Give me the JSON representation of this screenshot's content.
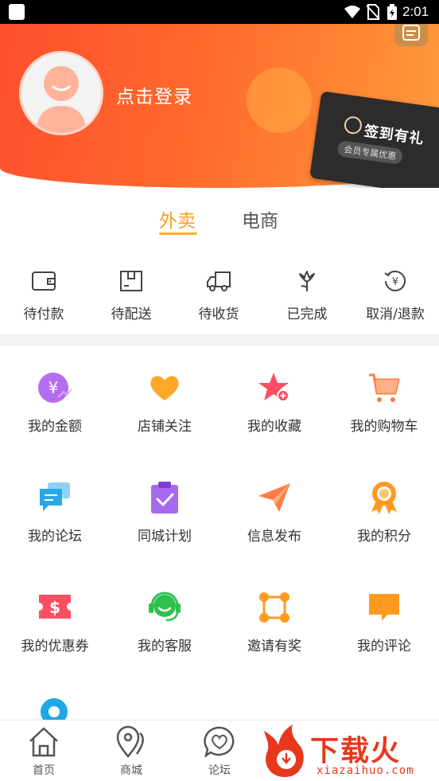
{
  "status_bar": {
    "time": "2:01"
  },
  "header": {
    "login_text": "点击登录",
    "signin_card": {
      "title": "签到有礼",
      "subtitle": "会员专属优惠"
    }
  },
  "tabs": [
    {
      "label": "外卖",
      "active": true
    },
    {
      "label": "电商",
      "active": false
    }
  ],
  "orders": [
    {
      "label": "待付款",
      "icon": "wallet-icon"
    },
    {
      "label": "待配送",
      "icon": "package-icon"
    },
    {
      "label": "待收货",
      "icon": "truck-icon"
    },
    {
      "label": "已完成",
      "icon": "flower-icon"
    },
    {
      "label": "取消/退款",
      "icon": "refund-icon"
    }
  ],
  "grid": [
    {
      "label": "我的金额",
      "icon": "wallet-yuan-icon",
      "color": "#b46cf0"
    },
    {
      "label": "店铺关注",
      "icon": "heart-icon",
      "color": "#ffa726"
    },
    {
      "label": "我的收藏",
      "icon": "star-add-icon",
      "color": "#ff4e62"
    },
    {
      "label": "我的购物车",
      "icon": "cart-icon",
      "color": "#ff7a3a"
    },
    {
      "label": "我的论坛",
      "icon": "chat-bubbles-icon",
      "color": "#29a8e8"
    },
    {
      "label": "同城计划",
      "icon": "clipboard-check-icon",
      "color": "#a66af0"
    },
    {
      "label": "信息发布",
      "icon": "paper-plane-icon",
      "color": "#ff7a45"
    },
    {
      "label": "我的积分",
      "icon": "medal-icon",
      "color": "#ff9a1e"
    },
    {
      "label": "我的优惠券",
      "icon": "coupon-icon",
      "color": "#ff4e62"
    },
    {
      "label": "我的客服",
      "icon": "headset-icon",
      "color": "#2ec24c"
    },
    {
      "label": "邀请有奖",
      "icon": "share-nodes-icon",
      "color": "#ff9a1e"
    },
    {
      "label": "我的评论",
      "icon": "comment-icon",
      "color": "#ff9a1e"
    }
  ],
  "bottom_nav": [
    {
      "label": "首页",
      "icon": "home-icon"
    },
    {
      "label": "商城",
      "icon": "map-pin-icon"
    },
    {
      "label": "论坛",
      "icon": "heart-chat-icon"
    }
  ],
  "watermark": {
    "text": "下载火",
    "url": "xiazaihuo.com"
  }
}
